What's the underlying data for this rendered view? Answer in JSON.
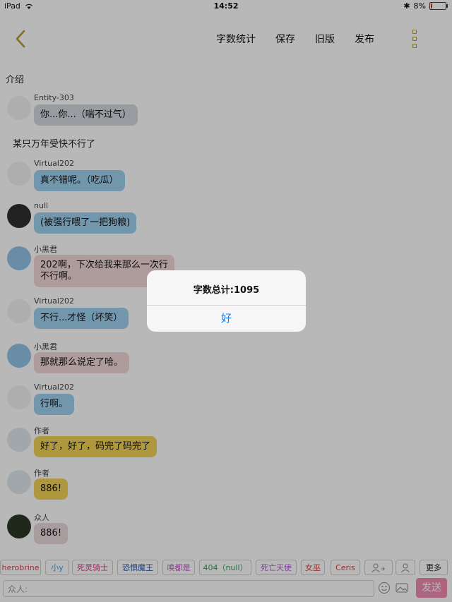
{
  "status": {
    "device": "iPad",
    "time": "14:52",
    "battery": "8%"
  },
  "nav": {
    "word_count": "字数统计",
    "save": "保存",
    "old_version": "旧版",
    "publish": "发布"
  },
  "intro_label": "介绍",
  "messages": [
    {
      "name": "Entity-303",
      "text": "你...你...（喘不过气）"
    },
    {
      "narration": "某只万年受快不行了"
    },
    {
      "name": "Virtual202",
      "text": "真不错呢。（吃瓜）"
    },
    {
      "name": "null",
      "text": "(被强行喂了一把狗粮)"
    },
    {
      "name": "小黑君",
      "text_line1": "202啊，下次给我来那么一次行",
      "text_line2": "不行啊。"
    },
    {
      "name": "Virtual202",
      "text": "不行...才怪（坏笑）"
    },
    {
      "name": "小黑君",
      "text": "那就那么说定了哈。"
    },
    {
      "name": "Virtual202",
      "text": "行啊。"
    },
    {
      "name": "作者",
      "text": "好了，好了，码完了码完了"
    },
    {
      "name": "作者",
      "text": "886!"
    },
    {
      "name": "众人",
      "text": "886!"
    }
  ],
  "characters": [
    {
      "label": "herobrine",
      "color": "#e0404a"
    },
    {
      "label": "小y",
      "color": "#3aa0d8"
    },
    {
      "label": "死灵骑士",
      "color": "#d0408a"
    },
    {
      "label": "恐惧魔王",
      "color": "#2a5aa8"
    },
    {
      "label": "唤都是",
      "color": "#c060c0"
    },
    {
      "label": "404（null）",
      "color": "#3aa060"
    },
    {
      "label": "死亡天使",
      "color": "#b060d0"
    },
    {
      "label": "女巫",
      "color": "#e04848"
    },
    {
      "label": "Ceris",
      "color": "#d04040"
    }
  ],
  "more_label": "更多",
  "input": {
    "placeholder": "众人:"
  },
  "send_label": "发送",
  "alert": {
    "message": "字数总计:1095",
    "ok": "好"
  },
  "colors": {
    "accent": "#b59a2b",
    "ios_blue": "#1479f7",
    "send": "#f08bb0"
  }
}
